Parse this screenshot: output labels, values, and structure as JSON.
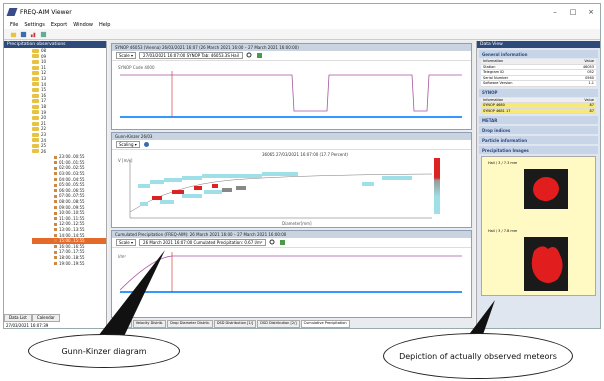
{
  "window": {
    "title": "FREQ-AIM Viewer",
    "controls": [
      "–",
      "□",
      "×"
    ]
  },
  "menu": [
    "File",
    "Settings",
    "Export",
    "Window",
    "Help"
  ],
  "left_panel": {
    "title": "Precipitation observations",
    "folders": [
      "08",
      "09",
      "10",
      "11",
      "12",
      "13",
      "14",
      "15",
      "16",
      "17",
      "18",
      "19",
      "20",
      "21",
      "22",
      "23",
      "24",
      "25",
      "26"
    ],
    "times": [
      "23:00..00:55",
      "01:00..01:55",
      "02:00..02:55",
      "03:00..03:55",
      "04:00..04:55",
      "05:00..05:55",
      "06:00..06:55",
      "07:00..07:55",
      "08:00..08:55",
      "09:00..09:55",
      "10:00..10:55",
      "11:00..11:55",
      "12:00..12:55",
      "13:00..13:55",
      "14:00..14:55",
      "15:00..15:55",
      "16:00..16:55",
      "17:00..17:55",
      "18:00..18:55",
      "19:00..19:55"
    ],
    "selected_time": "15:00..15:55",
    "tabs": [
      "Data List",
      "Calendar"
    ],
    "status": "27/03/2021 16:07:39"
  },
  "panels": {
    "top": {
      "header": "SYNOP 46053 (Vienna) 26/03/2021 16:07 (26 March 2021 16:00 – 27 March 2021 16:00:00)",
      "dropdown": "Scale ▾",
      "title": "27/03/2021 16:07:00 SYNOP Tab: 46053.3S Hail",
      "ylabel": "SYNOP Code 4000"
    },
    "middle": {
      "header": "Gunn-Kinzer 26/03",
      "dropdown": "Scaling ▾",
      "title": "36065 27/03/2021 16:07:00 (17.7 Percent)",
      "xlabel": "Diameter[mm]",
      "ylabel": "V [m/s]"
    },
    "bottom": {
      "header": "Cumulated Precipitation (FREQ-AIM): 26 March 2021 16:00 – 27 March 2021 16:00:00",
      "dropdown": "Scale ▾",
      "title": "26 March 2021 16:07:00 Cumulated Precipitation: 0.67 l/m²",
      "ylabel": "l/m²"
    }
  },
  "bottom_tabs": [
    "Particles",
    "Velocity Distrib.",
    "Drop Diameter Distrib.",
    "DSD Distribution [1/]",
    "DSD Distribution [2/]",
    "Cumulative Precipitation"
  ],
  "right_panel": {
    "title": "Data View",
    "sections": {
      "general": "General information",
      "synop": "SYNOP",
      "metar": "METAR",
      "drop_indices": "Drop indices",
      "particle": "Particle information",
      "images": "Precipitation Images"
    },
    "general_table": {
      "headers": [
        "Information",
        "Value"
      ],
      "rows": [
        [
          "Station",
          "46053"
        ],
        [
          "Telegram ID",
          "052"
        ],
        [
          "Serial Number",
          "0560"
        ],
        [
          "Software Version",
          "1.1"
        ]
      ]
    },
    "synop_table": {
      "headers": [
        "Information",
        "Value"
      ],
      "rows": [
        [
          "SYNOP 4680",
          "87"
        ],
        [
          "SYNOP 4681 17",
          "87"
        ]
      ]
    },
    "hail_images": [
      {
        "label": "Hail / 3 / 7.3 mm"
      },
      {
        "label": "Hail / 3 / 7.8 mm"
      }
    ]
  },
  "callouts": {
    "gunn": "Gunn-Kinzer diagram",
    "depiction": "Depiction of actually observed meteors"
  },
  "colors": {
    "accent": "#2d4a7a",
    "selection": "#e56a2a",
    "line": "#a855a0",
    "meteor": "#e11d1d"
  }
}
